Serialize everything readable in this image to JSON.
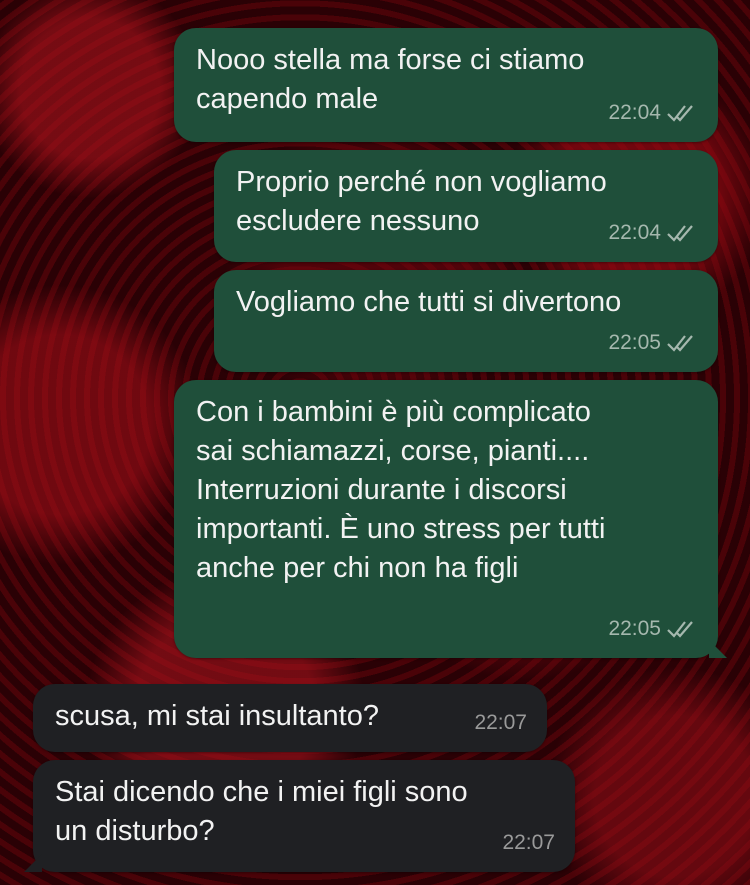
{
  "chat": {
    "messages": [
      {
        "direction": "out",
        "text": "Nooo stella ma forse ci stiamo\ncapendo male",
        "time": "22:04",
        "status": "read-ticks-icon"
      },
      {
        "direction": "out",
        "text": "Proprio perché non vogliamo\nescludere nessuno",
        "time": "22:04",
        "status": "read-ticks-icon"
      },
      {
        "direction": "out",
        "text": "Vogliamo che tutti si divertono",
        "time": "22:05",
        "status": "read-ticks-icon"
      },
      {
        "direction": "out",
        "text": "Con i bambini è più complicato\nsai schiamazzi, corse, pianti....\nInterruzioni durante i discorsi\nimportanti. È uno stress per tutti\nanche per chi non ha figli",
        "time": "22:05",
        "status": "read-ticks-icon"
      },
      {
        "direction": "in",
        "text": "scusa, mi stai insultanto?",
        "time": "22:07"
      },
      {
        "direction": "in",
        "text": "Stai dicendo che i miei figli sono\nun disturbo?",
        "time": "22:07"
      }
    ]
  },
  "colors": {
    "outgoing_bubble": "#1f4f3a",
    "incoming_bubble": "#1f2023",
    "background": "#3a0206"
  }
}
